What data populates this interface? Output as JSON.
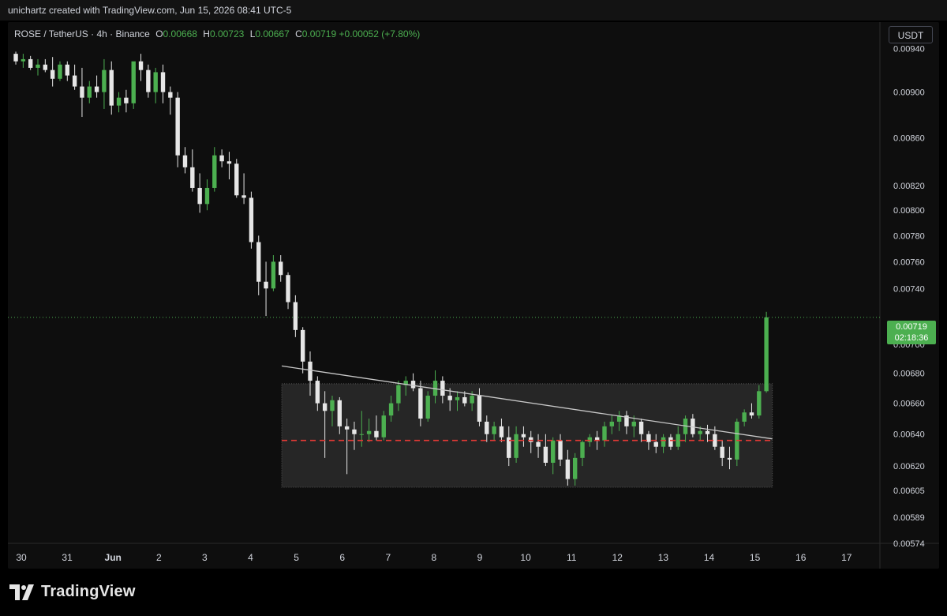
{
  "header": {
    "attribution": "unichartz created with TradingView.com, Jun 15, 2026 08:41 UTC-5"
  },
  "legend": {
    "symbol": "ROSE / TetherUS · 4h · Binance",
    "o_label": "O",
    "o_value": "0.00668",
    "h_label": "H",
    "h_value": "0.00723",
    "l_label": "L",
    "l_value": "0.00667",
    "c_label": "C",
    "c_value": "0.00719",
    "change": "+0.00052 (+7.80%)"
  },
  "currency": "USDT",
  "last_price": {
    "price": "0.00719",
    "countdown": "02:18:36"
  },
  "brand": {
    "name": "TradingView"
  },
  "colors": {
    "up": "#4caf50",
    "down": "#e6e6e6",
    "support_line": "#e53935",
    "trendline": "#c8c8c8",
    "box_fill": "#2a2a2a",
    "price_line": "#4caf50"
  },
  "chart_data": {
    "type": "candlestick",
    "instrument": "ROSE / TetherUS",
    "interval": "4h",
    "exchange": "Binance",
    "y_axis": {
      "ticks": [
        "0.00940",
        "0.00900",
        "0.00860",
        "0.00820",
        "0.00800",
        "0.00780",
        "0.00760",
        "0.00740",
        "0.00700",
        "0.00680",
        "0.00660",
        "0.00640",
        "0.00620",
        "0.00605",
        "0.00589",
        "0.00574"
      ],
      "ylim": [
        0.00574,
        0.00965
      ],
      "scale": "log"
    },
    "x_axis": {
      "ticks": [
        {
          "label": "30",
          "day": 0
        },
        {
          "label": "31",
          "day": 1
        },
        {
          "label": "Jun",
          "day": 2
        },
        {
          "label": "2",
          "day": 3
        },
        {
          "label": "3",
          "day": 4
        },
        {
          "label": "4",
          "day": 5
        },
        {
          "label": "5",
          "day": 6
        },
        {
          "label": "6",
          "day": 7
        },
        {
          "label": "7",
          "day": 8
        },
        {
          "label": "8",
          "day": 9
        },
        {
          "label": "9",
          "day": 10
        },
        {
          "label": "10",
          "day": 11
        },
        {
          "label": "11",
          "day": 12
        },
        {
          "label": "12",
          "day": 13
        },
        {
          "label": "13",
          "day": 14
        },
        {
          "label": "14",
          "day": 15
        },
        {
          "label": "15",
          "day": 16
        },
        {
          "label": "16",
          "day": 17
        },
        {
          "label": "17",
          "day": 18
        }
      ]
    },
    "annotations": {
      "range_box": {
        "day_start": 5.68,
        "day_end": 16.38,
        "price_top": 0.00673,
        "price_bottom": 0.00607
      },
      "support_line": {
        "price": 0.00636,
        "day_start": 5.68,
        "day_end": 16.38
      },
      "descending_trendline": {
        "day_start": 5.68,
        "price_start": 0.00685,
        "day_end": 16.38,
        "price_end": 0.00637
      },
      "last_price_line": 0.00719
    },
    "candles": [
      [
        0.00935,
        0.00937,
        0.00925,
        0.00928
      ],
      [
        0.00928,
        0.00935,
        0.00922,
        0.0093
      ],
      [
        0.0093,
        0.00933,
        0.0092,
        0.00922
      ],
      [
        0.00922,
        0.0093,
        0.00915,
        0.00925
      ],
      [
        0.00925,
        0.0093,
        0.00918,
        0.0092
      ],
      [
        0.0092,
        0.00932,
        0.00905,
        0.00912
      ],
      [
        0.00912,
        0.00928,
        0.0091,
        0.00925
      ],
      [
        0.00925,
        0.00928,
        0.0091,
        0.00915
      ],
      [
        0.00915,
        0.00925,
        0.00902,
        0.00905
      ],
      [
        0.00905,
        0.00922,
        0.00878,
        0.00895
      ],
      [
        0.00895,
        0.0091,
        0.0089,
        0.00905
      ],
      [
        0.00905,
        0.00915,
        0.00895,
        0.009
      ],
      [
        0.009,
        0.0093,
        0.00885,
        0.0092
      ],
      [
        0.0092,
        0.00928,
        0.0088,
        0.00888
      ],
      [
        0.00888,
        0.009,
        0.00882,
        0.00895
      ],
      [
        0.00895,
        0.00902,
        0.00882,
        0.0089
      ],
      [
        0.0089,
        0.00925,
        0.00885,
        0.00928
      ],
      [
        0.00928,
        0.00935,
        0.0091,
        0.0092
      ],
      [
        0.0092,
        0.00925,
        0.00895,
        0.009
      ],
      [
        0.009,
        0.00922,
        0.0089,
        0.00918
      ],
      [
        0.00918,
        0.00925,
        0.0089,
        0.009
      ],
      [
        0.009,
        0.00905,
        0.0088,
        0.00895
      ],
      [
        0.00895,
        0.009,
        0.00835,
        0.00845
      ],
      [
        0.00845,
        0.00852,
        0.0083,
        0.00835
      ],
      [
        0.00835,
        0.0085,
        0.00815,
        0.00818
      ],
      [
        0.00818,
        0.0083,
        0.00798,
        0.00805
      ],
      [
        0.00805,
        0.00825,
        0.008,
        0.00818
      ],
      [
        0.00818,
        0.00852,
        0.00815,
        0.00845
      ],
      [
        0.00845,
        0.0085,
        0.00835,
        0.0084
      ],
      [
        0.0084,
        0.00848,
        0.00825,
        0.00838
      ],
      [
        0.00838,
        0.00842,
        0.0081,
        0.00812
      ],
      [
        0.00812,
        0.0083,
        0.00805,
        0.0081
      ],
      [
        0.0081,
        0.00815,
        0.0077,
        0.00775
      ],
      [
        0.00775,
        0.0078,
        0.00735,
        0.00745
      ],
      [
        0.00745,
        0.0076,
        0.0072,
        0.0074
      ],
      [
        0.0074,
        0.00765,
        0.00738,
        0.0076
      ],
      [
        0.0076,
        0.00765,
        0.00745,
        0.0075
      ],
      [
        0.0075,
        0.00752,
        0.00725,
        0.0073
      ],
      [
        0.0073,
        0.00735,
        0.00705,
        0.0071
      ],
      [
        0.0071,
        0.00712,
        0.0068,
        0.00688
      ],
      [
        0.00688,
        0.00695,
        0.00665,
        0.00675
      ],
      [
        0.00675,
        0.00678,
        0.00655,
        0.0066
      ],
      [
        0.0066,
        0.00668,
        0.00625,
        0.00655
      ],
      [
        0.00655,
        0.00665,
        0.00645,
        0.00662
      ],
      [
        0.00662,
        0.00664,
        0.0064,
        0.00645
      ],
      [
        0.00645,
        0.0065,
        0.00615,
        0.00643
      ],
      [
        0.00643,
        0.00648,
        0.0063,
        0.0064
      ],
      [
        0.0064,
        0.00655,
        0.00632,
        0.0064
      ],
      [
        0.0064,
        0.0065,
        0.00635,
        0.00642
      ],
      [
        0.00642,
        0.00652,
        0.00636,
        0.00638
      ],
      [
        0.00638,
        0.00655,
        0.00636,
        0.00652
      ],
      [
        0.00652,
        0.00665,
        0.00648,
        0.0066
      ],
      [
        0.0066,
        0.00675,
        0.00655,
        0.00672
      ],
      [
        0.00672,
        0.00678,
        0.00665,
        0.00675
      ],
      [
        0.00675,
        0.0068,
        0.00668,
        0.0067
      ],
      [
        0.0067,
        0.00675,
        0.00645,
        0.0065
      ],
      [
        0.0065,
        0.00668,
        0.00648,
        0.00665
      ],
      [
        0.00665,
        0.00682,
        0.0066,
        0.00675
      ],
      [
        0.00675,
        0.00678,
        0.0066,
        0.00665
      ],
      [
        0.00665,
        0.0067,
        0.00655,
        0.00662
      ],
      [
        0.00662,
        0.00668,
        0.00655,
        0.00664
      ],
      [
        0.00664,
        0.00668,
        0.00658,
        0.0066
      ],
      [
        0.0066,
        0.00668,
        0.00655,
        0.00665
      ],
      [
        0.00665,
        0.0067,
        0.00645,
        0.00648
      ],
      [
        0.00648,
        0.00652,
        0.00635,
        0.0064
      ],
      [
        0.0064,
        0.00648,
        0.00636,
        0.00645
      ],
      [
        0.00645,
        0.0065,
        0.00635,
        0.00638
      ],
      [
        0.00638,
        0.00645,
        0.0062,
        0.00625
      ],
      [
        0.00625,
        0.00645,
        0.00622,
        0.0064
      ],
      [
        0.0064,
        0.00645,
        0.00632,
        0.00638
      ],
      [
        0.00638,
        0.00642,
        0.00628,
        0.00635
      ],
      [
        0.00635,
        0.0064,
        0.00625,
        0.00632
      ],
      [
        0.00632,
        0.0064,
        0.0062,
        0.00622
      ],
      [
        0.00622,
        0.00638,
        0.00615,
        0.00636
      ],
      [
        0.00636,
        0.0064,
        0.0062,
        0.00624
      ],
      [
        0.00624,
        0.0063,
        0.00608,
        0.00612
      ],
      [
        0.00612,
        0.00628,
        0.00608,
        0.00625
      ],
      [
        0.00625,
        0.00636,
        0.0062,
        0.00635
      ],
      [
        0.00635,
        0.0064,
        0.00632,
        0.00638
      ],
      [
        0.00638,
        0.00642,
        0.0063,
        0.00636
      ],
      [
        0.00636,
        0.00648,
        0.00632,
        0.00645
      ],
      [
        0.00645,
        0.00652,
        0.0064,
        0.00648
      ],
      [
        0.00648,
        0.00655,
        0.00642,
        0.00652
      ],
      [
        0.00652,
        0.00655,
        0.0064,
        0.00645
      ],
      [
        0.00645,
        0.00652,
        0.00638,
        0.00648
      ],
      [
        0.00648,
        0.0065,
        0.00635,
        0.0064
      ],
      [
        0.0064,
        0.00642,
        0.0063,
        0.00635
      ],
      [
        0.00635,
        0.0064,
        0.00628,
        0.00632
      ],
      [
        0.00632,
        0.0064,
        0.00628,
        0.00638
      ],
      [
        0.00638,
        0.0064,
        0.0063,
        0.00632
      ],
      [
        0.00632,
        0.00645,
        0.0063,
        0.0064
      ],
      [
        0.0064,
        0.00652,
        0.00635,
        0.0065
      ],
      [
        0.0065,
        0.00653,
        0.00638,
        0.0064
      ],
      [
        0.0064,
        0.00645,
        0.00636,
        0.00642
      ],
      [
        0.00642,
        0.00646,
        0.00635,
        0.0064
      ],
      [
        0.0064,
        0.00645,
        0.0063,
        0.00632
      ],
      [
        0.00632,
        0.00636,
        0.0062,
        0.00625
      ],
      [
        0.00625,
        0.00632,
        0.00618,
        0.00624
      ],
      [
        0.00624,
        0.0065,
        0.0062,
        0.00648
      ],
      [
        0.00648,
        0.00656,
        0.00645,
        0.00654
      ],
      [
        0.00654,
        0.0066,
        0.0065,
        0.00652
      ],
      [
        0.00652,
        0.00672,
        0.0065,
        0.00668
      ],
      [
        0.00668,
        0.00723,
        0.00667,
        0.00719
      ]
    ]
  }
}
